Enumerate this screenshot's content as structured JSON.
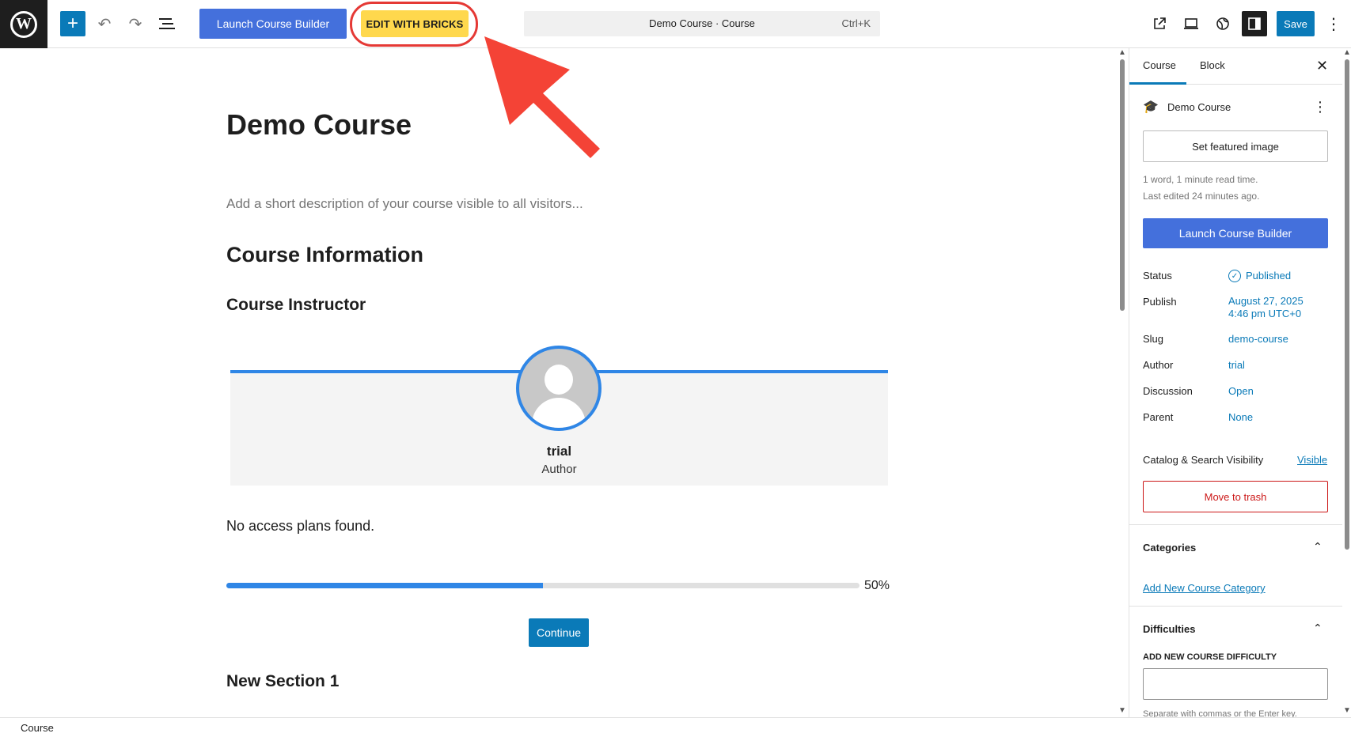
{
  "topbar": {
    "logo_letter": "W",
    "add_block_icon": "plus-icon",
    "undo_icon": "undo-icon",
    "redo_icon": "redo-icon",
    "outline_icon": "list-view-icon",
    "launch_label": "Launch Course Builder",
    "bricks_label": "EDIT WITH BRICKS",
    "command_title": "Demo Course · Course",
    "command_shortcut": "Ctrl+K",
    "save_label": "Save",
    "accent": "#0a7ab8",
    "launch_color": "#4470dc",
    "bricks_color": "#ffd84d",
    "annotation_color": "#e53935"
  },
  "canvas": {
    "title": "Demo Course",
    "excerpt_placeholder": "Add a short description of your course visible to all visitors...",
    "info_heading": "Course Information",
    "instructor_heading": "Course Instructor",
    "instructor_name": "trial",
    "instructor_role": "Author",
    "access_text": "No access plans found.",
    "progress_percent": 50,
    "progress_label": "50%",
    "continue_label": "Continue",
    "section_heading": "New Section 1"
  },
  "sidebar": {
    "tabs": [
      "Course",
      "Block"
    ],
    "post_name": "Demo Course",
    "featured_label": "Set featured image",
    "meta_words": "1 word, 1 minute read time.",
    "meta_edited": "Last edited 24 minutes ago.",
    "launch_label": "Launch Course Builder",
    "rows": {
      "status_label": "Status",
      "status_value": "Published",
      "publish_label": "Publish",
      "publish_date": "August 27, 2025",
      "publish_time": "4:46 pm UTC+0",
      "slug_label": "Slug",
      "slug_value": "demo-course",
      "author_label": "Author",
      "author_value": "trial",
      "discussion_label": "Discussion",
      "discussion_value": "Open",
      "parent_label": "Parent",
      "parent_value": "None",
      "visibility_label": "Catalog & Search Visibility",
      "visibility_value": "Visible"
    },
    "trash_label": "Move to trash",
    "categories_title": "Categories",
    "add_category_label": "Add New Course Category",
    "difficulties_title": "Difficulties",
    "difficulty_field_label": "ADD NEW COURSE DIFFICULTY",
    "difficulty_value": "",
    "difficulty_help": "Separate with commas or the Enter key."
  },
  "footer": {
    "breadcrumb": "Course"
  }
}
